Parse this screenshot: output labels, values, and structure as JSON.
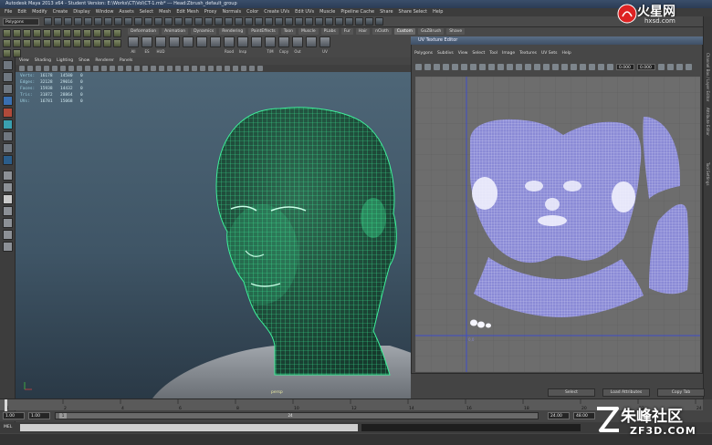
{
  "window": {
    "title": "Autodesk Maya 2013 x64 - Student Version: E:\\Works\\CT\\Vol\\CT-1.mb*   ---   Head:Zbrush_default_group"
  },
  "menubar": {
    "items": [
      "File",
      "Edit",
      "Modify",
      "Create",
      "Display",
      "Window",
      "Assets",
      "Select",
      "Mesh",
      "Edit Mesh",
      "Proxy",
      "Normals",
      "Color",
      "Create UVs",
      "Edit UVs",
      "Muscle",
      "Pipeline Cache",
      "Share",
      "Share Select",
      "Help"
    ]
  },
  "status_line": {
    "mode": "Polygons"
  },
  "shelf": {
    "tabs": [
      "Deformation",
      "Animation",
      "Dynamics",
      "Rendering",
      "PaintEffects",
      "Toon",
      "Muscle",
      "PLabs",
      "Fur",
      "Hair",
      "nCloth",
      "Custom",
      "GoZBrush",
      "Shave"
    ],
    "active_tab": "Custom",
    "tool_captions": [
      "All",
      "ES",
      "HUD",
      "",
      "",
      "",
      "",
      "Rood",
      "Insp",
      "",
      "T/M",
      "Copy",
      "Out",
      "",
      "UV"
    ]
  },
  "viewport": {
    "menu": [
      "View",
      "Shading",
      "Lighting",
      "Show",
      "Renderer",
      "Panels"
    ],
    "hud": [
      {
        "label": "Verts:",
        "a": "16178",
        "b": "14580",
        "c": "0"
      },
      {
        "label": "Edges:",
        "a": "32128",
        "b": "29016",
        "c": "0"
      },
      {
        "label": "Faces:",
        "a": "15938",
        "b": "14432",
        "c": "0"
      },
      {
        "label": "Tris:",
        "a": "31872",
        "b": "28864",
        "c": "0"
      },
      {
        "label": "UVs:",
        "a": "16781",
        "b": "15068",
        "c": "0"
      }
    ],
    "camera": "persp"
  },
  "uv_editor": {
    "title": "UV Texture Editor",
    "menu": [
      "Polygons",
      "Subdivs",
      "View",
      "Select",
      "Tool",
      "Image",
      "Textures",
      "UV Sets",
      "Help"
    ],
    "field_values": [
      "0.000",
      "0.000"
    ],
    "origin_label": "0,0",
    "colors": {
      "uv_fill": "#8a8ad6",
      "uv_line": "#f2f2ff",
      "grid_bg": "#6d6d6d",
      "axis": "#3e4dc8"
    }
  },
  "attribute_buttons": [
    "Select",
    "Load Attributes",
    "Copy Tab"
  ],
  "timeline": {
    "ticks": [
      "1",
      "2",
      "4",
      "6",
      "8",
      "10",
      "12",
      "14",
      "16",
      "18",
      "20",
      "22",
      "24"
    ],
    "current": "1"
  },
  "range": {
    "start": "1.00",
    "start2": "1.00",
    "marker": "1",
    "end_marker": "24",
    "end": "24.00",
    "end2": "48.00"
  },
  "command": {
    "label": "MEL"
  },
  "side_panels": [
    "Channel Box / Layer Editor",
    "Attribute Editor",
    "Tool Settings"
  ],
  "watermarks": {
    "top_logo": "火星网",
    "top_url": "hxsd.com",
    "bottom_logo": "朱峰社区",
    "bottom_url": "ZF3D.COM"
  },
  "model": {
    "wire_color": "#3ef09a",
    "shoulder_color": "#8e9399"
  }
}
